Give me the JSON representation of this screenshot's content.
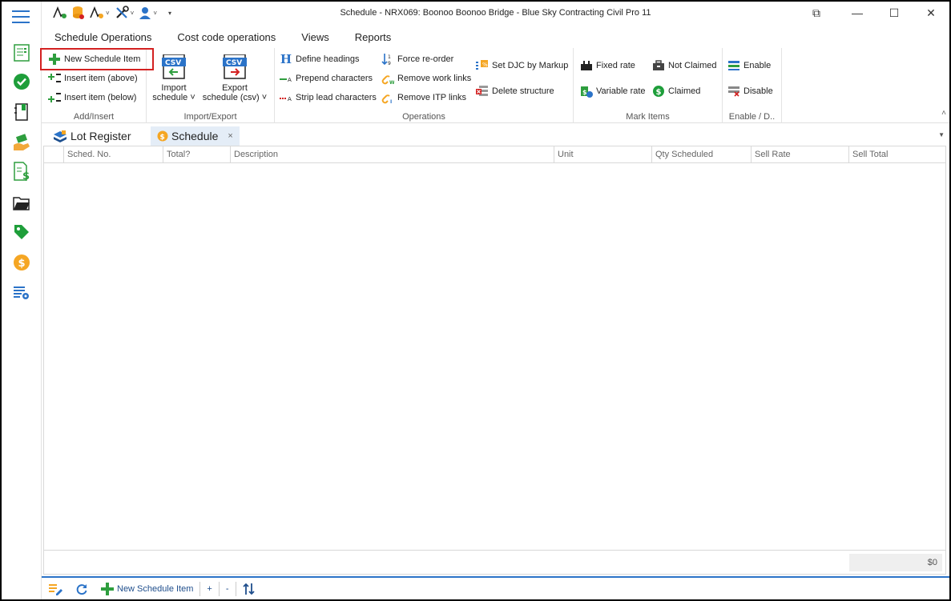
{
  "window": {
    "title": "Schedule - NRX069: Boonoo Boonoo Bridge  - Blue Sky Contracting Civil Pro 11",
    "restore_glyph": "⧉",
    "minimize_glyph": "—",
    "maximize_glyph": "☐",
    "close_glyph": "✕"
  },
  "ribbon_tabs": [
    {
      "label": "Schedule Operations"
    },
    {
      "label": "Cost code operations"
    },
    {
      "label": "Views"
    },
    {
      "label": "Reports"
    }
  ],
  "groups": {
    "add_insert": {
      "label": "Add/Insert",
      "new_item": "New Schedule Item",
      "insert_above": "Insert item (above)",
      "insert_below": "Insert item (below)"
    },
    "import_export": {
      "label": "Import/Export",
      "import_line1": "Import",
      "import_line2": "schedule ˅",
      "export_line1": "Export",
      "export_line2": "schedule (csv) ˅",
      "csv_text": "CSV"
    },
    "operations": {
      "label": "Operations",
      "define_headings": "Define headings",
      "prepend": "Prepend characters",
      "strip": "Strip lead characters",
      "force_reorder": "Force re-order",
      "remove_work_links": "Remove work links",
      "remove_itp_links": "Remove ITP links",
      "set_djc": "Set DJC by Markup",
      "delete_structure": "Delete structure"
    },
    "mark_items": {
      "label": "Mark Items",
      "fixed_rate": "Fixed rate",
      "variable_rate": "Variable rate",
      "not_claimed": "Not Claimed",
      "claimed": "Claimed"
    },
    "enable_disable": {
      "label": "Enable / D..",
      "enable": "Enable",
      "disable": "Disable"
    }
  },
  "doc_tabs": [
    {
      "label": "Lot Register"
    },
    {
      "label": "Schedule",
      "close": "×"
    }
  ],
  "grid": {
    "columns": [
      "Sched. No.",
      "Total?",
      "Description",
      "Unit",
      "Qty Scheduled",
      "Sell Rate",
      "Sell Total"
    ],
    "total": "$0"
  },
  "bottom_bar": {
    "new_item": "New Schedule Item",
    "plus": "+",
    "minus": "-"
  },
  "colors": {
    "accent_blue": "#2b73c8",
    "highlight_red": "#d32121",
    "green": "#2e9e3e",
    "orange": "#f5a623"
  }
}
